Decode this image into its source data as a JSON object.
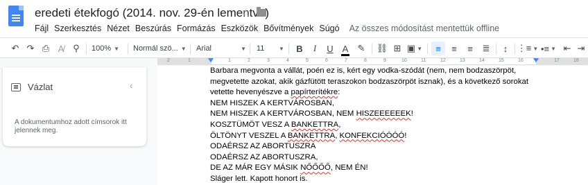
{
  "document": {
    "title": "eredeti étekfogó (2014. nov. 29-én lementve)"
  },
  "menu": {
    "items": [
      "Fájl",
      "Szerkesztés",
      "Nézet",
      "Beszúrás",
      "Formázás",
      "Eszközök",
      "Bővítmények",
      "Súgó"
    ],
    "save_status": "Az összes módosítást mentettük offline"
  },
  "toolbar": {
    "zoom": "100%",
    "style": "Normál szö...",
    "font": "Arial",
    "font_size": "11",
    "bold": "B",
    "italic": "I",
    "underline": "U",
    "text_color": "A"
  },
  "ruler": {
    "labels": [
      "2",
      "1",
      "1",
      "2",
      "3",
      "4",
      "5",
      "6",
      "7",
      "8",
      "9",
      "10",
      "11",
      "12",
      "13",
      "14",
      "15",
      "16",
      "17",
      "18"
    ]
  },
  "outline": {
    "title": "Vázlat",
    "hint": "A dokumentumhoz adott címsorok itt jelennek meg."
  },
  "body": {
    "lines": [
      {
        "parts": [
          {
            "t": "Barbara megvonta a vállát, poén ez is, kért egy vodka-szódát (nem, nem bodzaszörpöt,"
          }
        ]
      },
      {
        "parts": [
          {
            "t": "megvetette azokat, akik gázfütött teraszokon bodzaszörpöt isznak), és a következő sorokat"
          }
        ]
      },
      {
        "parts": [
          {
            "t": "vetette hevenyészve a "
          },
          {
            "t": "papírterítékre",
            "err": true
          },
          {
            "t": ":"
          }
        ]
      },
      {
        "parts": [
          {
            "t": "NEM HISZEK A KERTVÁROSBAN,"
          }
        ]
      },
      {
        "parts": [
          {
            "t": "NEM HISZEK A KERTVÁROSBAN, NEM "
          },
          {
            "t": "HISZEEEEEEK",
            "err": true
          },
          {
            "t": "!"
          }
        ]
      },
      {
        "parts": [
          {
            "t": "KOSZTÜMÖT VESZ A "
          },
          {
            "t": "BANKETTRA",
            "err": true
          },
          {
            "t": ","
          }
        ]
      },
      {
        "parts": [
          {
            "t": "ÖLTÖNYT VESZEL A "
          },
          {
            "t": "BANKETTRA",
            "err": true
          },
          {
            "t": ", "
          },
          {
            "t": "KONFEKCIÓÓÓÓ",
            "err": true
          },
          {
            "t": "!"
          }
        ]
      },
      {
        "parts": [
          {
            "t": "ODAÉRSZ AZ ABORTUSZRA"
          }
        ]
      },
      {
        "parts": [
          {
            "t": "ODAÉRSZ AZ ABORTUSZRA,"
          }
        ]
      },
      {
        "parts": [
          {
            "t": "DE AZ MÁR EGY MÁSIK "
          },
          {
            "t": "NŐŐŐŐ",
            "err": true
          },
          {
            "t": ", NEM ÉN!"
          }
        ]
      },
      {
        "parts": [
          {
            "t": "Sláger lett. Kapott honort is."
          }
        ]
      }
    ]
  },
  "colors": {
    "accent": "#1a73e8",
    "docs_blue": "#4285f4",
    "spellcheck": "#d93025"
  }
}
